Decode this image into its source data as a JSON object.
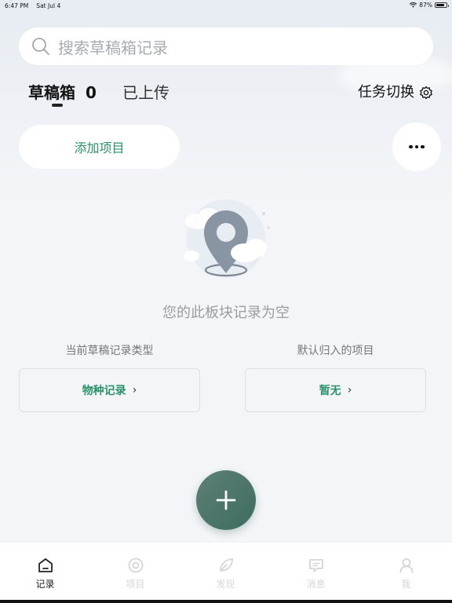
{
  "status_bar": {
    "time": "6:47 PM",
    "date": "Sat Jul 4",
    "battery_text": "87%",
    "battery_level": 0.87
  },
  "search": {
    "placeholder": "搜索草稿箱记录"
  },
  "tabs": {
    "draft_label": "草稿箱",
    "draft_count": "0",
    "uploaded_label": "已上传",
    "task_switch_label": "任务切换"
  },
  "actions": {
    "add_project_label": "添加项目"
  },
  "empty_state": {
    "message": "您的此板块记录为空"
  },
  "settings": {
    "record_type": {
      "label": "当前草稿记录类型",
      "value": "物种记录"
    },
    "default_project": {
      "label": "默认归入的项目",
      "value": "暂无"
    }
  },
  "bottom_nav": {
    "items": [
      {
        "label": "记录",
        "icon": "home-icon",
        "active": true
      },
      {
        "label": "项目",
        "icon": "target-icon",
        "active": false
      },
      {
        "label": "发现",
        "icon": "leaf-icon",
        "active": false
      },
      {
        "label": "消息",
        "icon": "message-icon",
        "active": false
      },
      {
        "label": "我",
        "icon": "user-icon",
        "active": false
      }
    ]
  },
  "colors": {
    "accent": "#2a9168",
    "fab": "#4a776b"
  }
}
